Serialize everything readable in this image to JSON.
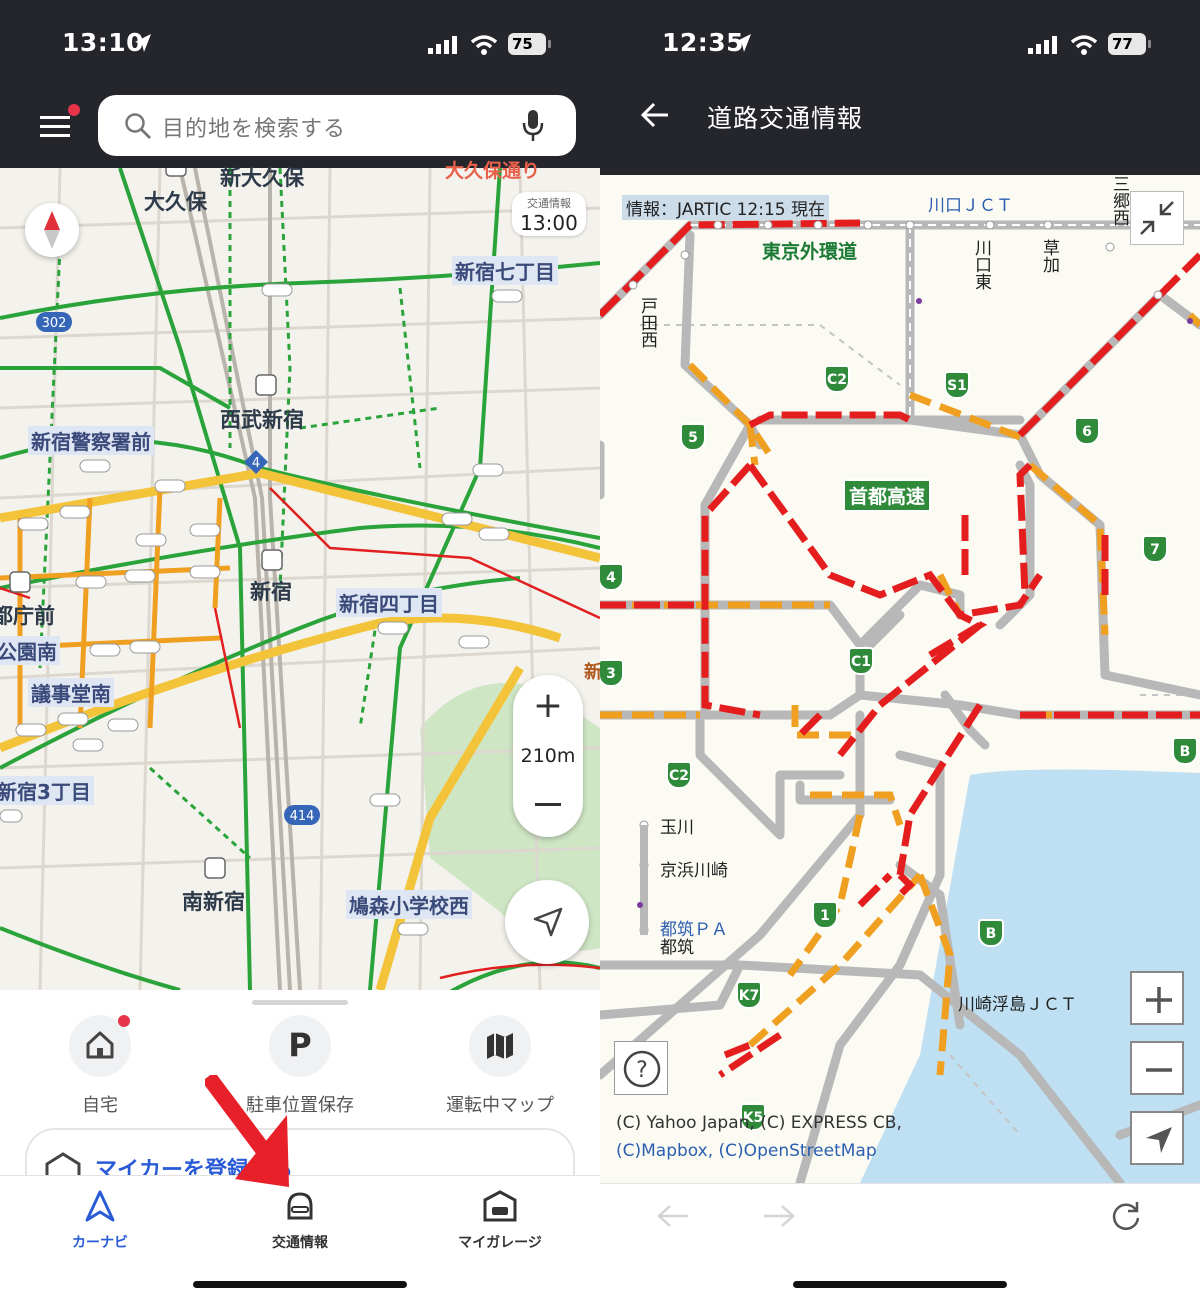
{
  "left": {
    "status": {
      "time": "13:10",
      "battery": "75"
    },
    "search": {
      "placeholder": "目的地を検索する"
    },
    "traffic_badge": {
      "label": "交通情報",
      "time": "13:00"
    },
    "map_labels": {
      "shin_okubo": "新大久保",
      "okubo": "大久保",
      "okubo_dori": "大久保通り",
      "shinjuku7": "新宿七丁目",
      "seibu": "西武新宿",
      "police": "新宿警察署前",
      "shinjuku": "新宿",
      "shinjuku4": "新宿四丁目",
      "tochomae": "都庁前",
      "koen_minami": "公園南",
      "gijido": "議事堂南",
      "shinjuku3": "新宿3丁目",
      "minami_shinjuku": "南新宿",
      "hatomori": "鳩森小学校西",
      "shin": "新",
      "route302": "302",
      "route4": "4",
      "route414": "414"
    },
    "zoom_scale": "210m",
    "quick_actions": [
      {
        "label": "自宅",
        "icon": "home-icon"
      },
      {
        "label": "駐車位置保存",
        "icon": "parking-icon"
      },
      {
        "label": "運転中マップ",
        "icon": "map-icon"
      }
    ],
    "mycar": "マイカーを登録する",
    "tabs": [
      {
        "label": "カーナビ",
        "icon": "navigation-icon",
        "active": true
      },
      {
        "label": "交通情報",
        "icon": "traffic-icon",
        "active": false
      },
      {
        "label": "マイガレージ",
        "icon": "garage-icon",
        "active": false
      }
    ],
    "colors": {
      "accent": "#2a5bd7",
      "arrow": "#e8202a",
      "jam": "#e02020",
      "slow": "#f0a020",
      "clear": "#2aa43a"
    }
  },
  "right": {
    "status": {
      "time": "12:35",
      "battery": "77"
    },
    "title": "道路交通情報",
    "info_stamp": "情報：JARTIC 12:15 現在",
    "labels": {
      "gaikan": "東京外環道",
      "shuto": "首都高速",
      "kawaguchi_jct": "川口ＪＣＴ",
      "kawaguchi_higashi": "川口東",
      "soka": "草加",
      "toda_nishi": "戸田西",
      "misato_nishi": "三郷西",
      "tamagawa": "玉川",
      "keihin_kawasaki": "京浜川崎",
      "tsuzuki_pa": "都筑ＰＡ",
      "tsuzuki": "都筑",
      "kawasaki_ukishima": "川崎浮島ＪＣＴ"
    },
    "credits": [
      "(C) Yahoo Japan, (C) EXPRESS CB,",
      "(C)Mapbox, (C)OpenStreetMap"
    ],
    "route_shields": [
      "C2",
      "S1",
      "5",
      "6",
      "7",
      "4",
      "3",
      "C1",
      "C2",
      "1",
      "B",
      "K7",
      "B",
      "K5"
    ]
  }
}
